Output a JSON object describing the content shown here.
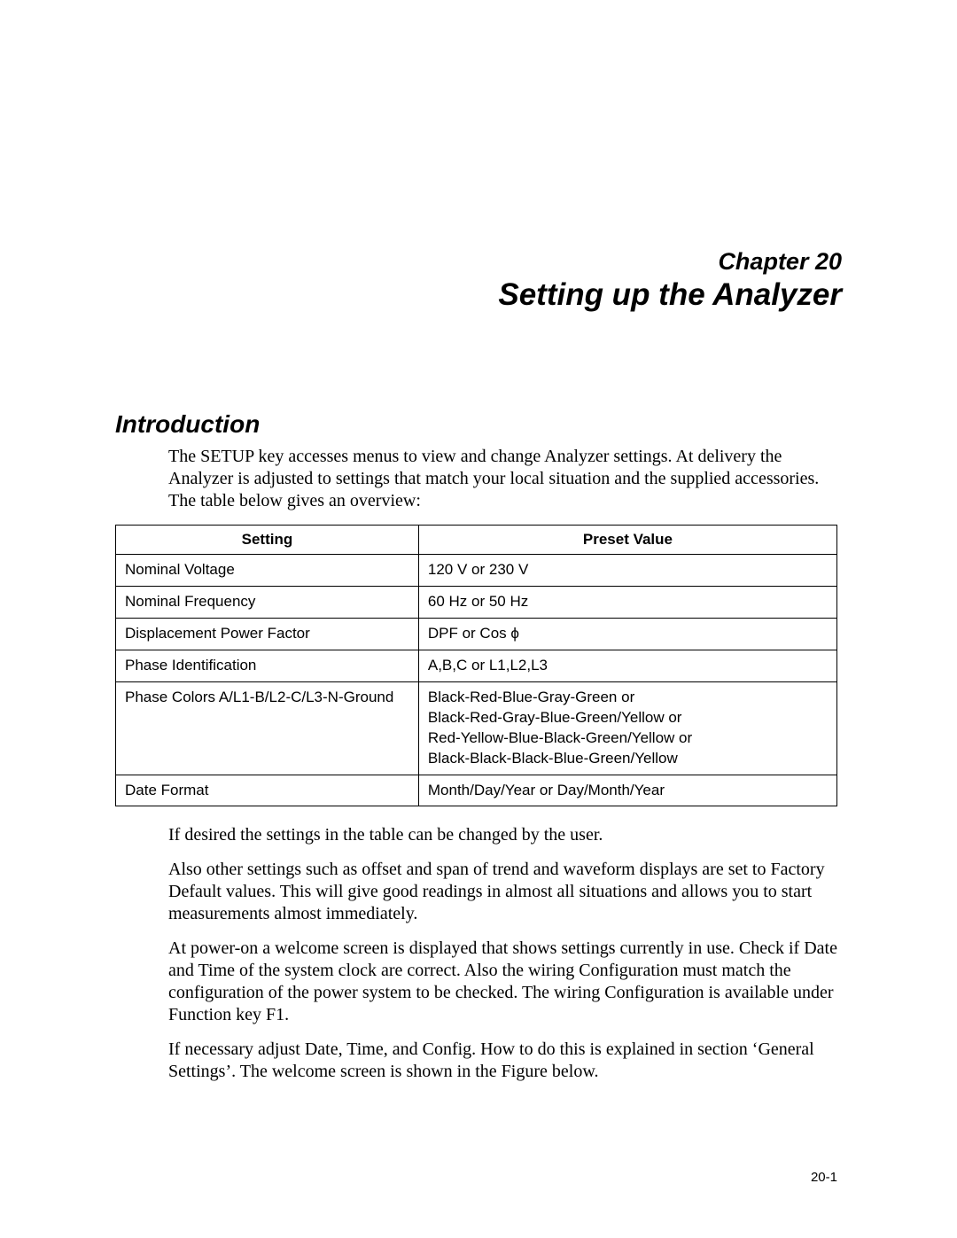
{
  "chapter": {
    "label": "Chapter 20",
    "title": "Setting up the Analyzer"
  },
  "section": {
    "heading": "Introduction",
    "intro": "The SETUP key accesses menus to view and change Analyzer settings. At delivery the Analyzer is adjusted to settings that match your local situation and the supplied accessories. The table below gives an overview:"
  },
  "table": {
    "headers": {
      "setting": "Setting",
      "preset": "Preset Value"
    },
    "rows": [
      {
        "setting": "Nominal Voltage",
        "preset": "120 V or 230 V"
      },
      {
        "setting": "Nominal Frequency",
        "preset": "60 Hz or 50 Hz"
      },
      {
        "setting": "Displacement Power Factor",
        "preset": "DPF or Cos ϕ"
      },
      {
        "setting": "Phase Identification",
        "preset": "A,B,C or L1,L2,L3"
      },
      {
        "setting": "Phase Colors A/L1-B/L2-C/L3-N-Ground",
        "preset": "Black-Red-Blue-Gray-Green or\nBlack-Red-Gray-Blue-Green/Yellow or\nRed-Yellow-Blue-Black-Green/Yellow or\nBlack-Black-Black-Blue-Green/Yellow"
      },
      {
        "setting": "Date Format",
        "preset": "Month/Day/Year or Day/Month/Year"
      }
    ]
  },
  "paragraphs": {
    "p1": "If desired the settings in the table can be changed by the user.",
    "p2": "Also other settings such as offset and span of trend and waveform displays are set to Factory Default values. This will give good readings in almost all situations and allows you to start measurements almost immediately.",
    "p3": "At power-on a welcome screen is displayed that shows settings currently in use. Check if Date and Time of the system clock are correct. Also the wiring Configuration must match the configuration of the power system to be checked. The wiring Configuration is available under Function key F1.",
    "p4": "If necessary adjust Date, Time, and Config. How to do this is explained in section ‘General Settings’. The welcome screen is shown in the Figure below."
  },
  "page_number": "20-1"
}
